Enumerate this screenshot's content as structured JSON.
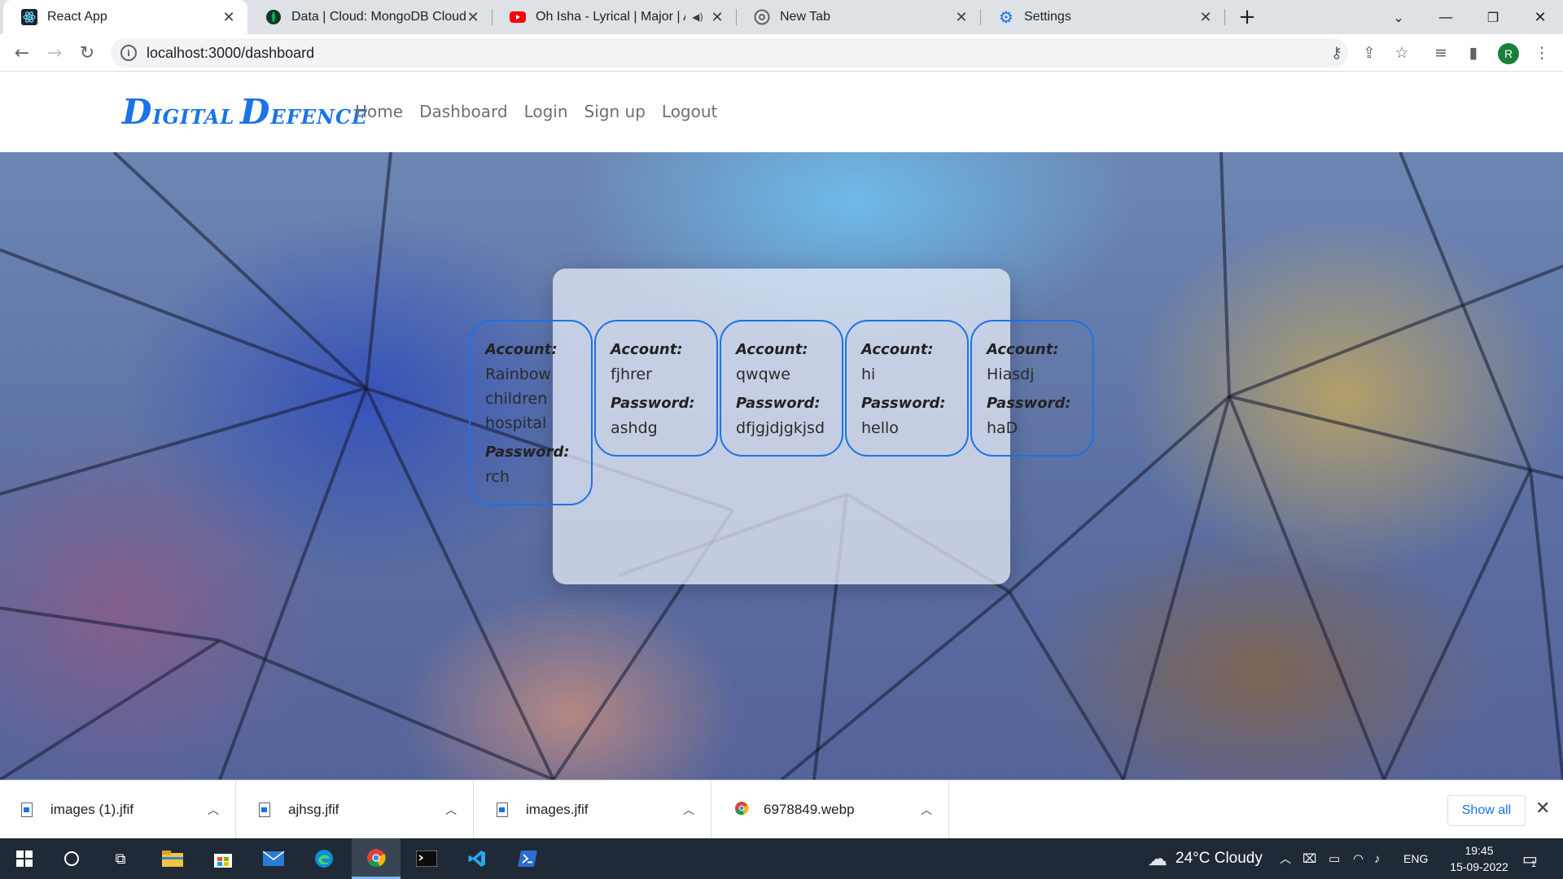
{
  "browser": {
    "tabs": [
      {
        "title": "React App",
        "icon": "react-icon",
        "active": true
      },
      {
        "title": "Data | Cloud: MongoDB Cloud",
        "icon": "mongodb-leaf-icon",
        "active": false
      },
      {
        "title": "Oh Isha - Lyrical | Major | Adi",
        "icon": "youtube-icon",
        "active": false
      },
      {
        "title": "New Tab",
        "icon": "chrome-icon",
        "active": false
      },
      {
        "title": "Settings",
        "icon": "gear-icon",
        "active": false
      }
    ],
    "url": "localhost:3000/dashboard",
    "profile_initial": "R"
  },
  "site": {
    "brand": {
      "d1": "D",
      "w1": "IGITAL",
      "d2": "D",
      "w2": "EFENCE"
    },
    "nav": [
      "Home",
      "Dashboard",
      "Login",
      "Sign up",
      "Logout"
    ]
  },
  "dashboard": {
    "account_label": "Account:",
    "password_label": "Password:",
    "entries": [
      {
        "account": "Rainbow children hospital",
        "password": "rch"
      },
      {
        "account": "fjhrer",
        "password": "ashdg"
      },
      {
        "account": "qwqwe",
        "password": "dfjgjdjgkjsd"
      },
      {
        "account": "hi",
        "password": "hello"
      },
      {
        "account": "Hiasdj",
        "password": "haD"
      }
    ]
  },
  "downloads": {
    "items": [
      "images (1).jfif",
      "ajhsg.jfif",
      "images.jfif",
      "6978849.webp"
    ],
    "show_all": "Show all"
  },
  "taskbar": {
    "weather": "24°C  Cloudy",
    "language": "ENG",
    "time": "19:45",
    "date": "15-09-2022",
    "notifications": "1"
  },
  "colors": {
    "accent": "#1a73e8",
    "nav_text": "#6f6f6f"
  }
}
